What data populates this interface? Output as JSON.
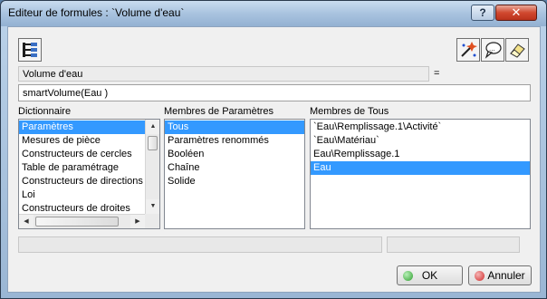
{
  "window": {
    "title": "Editeur de formules : `Volume d'eau`",
    "help_label": "?",
    "close_label": "✕"
  },
  "toolbar": {
    "left_icon": "formula-tree-icon",
    "right_icons": [
      "wizard-icon",
      "speech-bubble-icon",
      "eraser-icon"
    ]
  },
  "parameter_name": "Volume d'eau",
  "equals_sign": "=",
  "formula": "smartVolume(Eau )",
  "dictionary": {
    "label": "Dictionnaire",
    "items": [
      "Paramètres",
      "Mesures de pièce",
      "Constructeurs de cercles",
      "Table de paramétrage",
      "Constructeurs de directions",
      "Loi",
      "Constructeurs de droites"
    ],
    "selected_index": 0
  },
  "parameter_members": {
    "label": "Membres de Paramètres",
    "items": [
      "Tous",
      "Paramètres renommés",
      "Booléen",
      "Chaîne",
      "Solide"
    ],
    "selected_index": 0
  },
  "all_members": {
    "label": "Membres de Tous",
    "items": [
      "`Eau\\Remplissage.1\\Activité`",
      "`Eau\\Matériau`",
      "Eau\\Remplissage.1",
      "Eau"
    ],
    "selected_index": 3
  },
  "buttons": {
    "ok": "OK",
    "cancel": "Annuler"
  },
  "colors": {
    "selection": "#3399ff",
    "ok_dot": "#2e9e2e",
    "cancel_dot": "#d12a2a"
  }
}
